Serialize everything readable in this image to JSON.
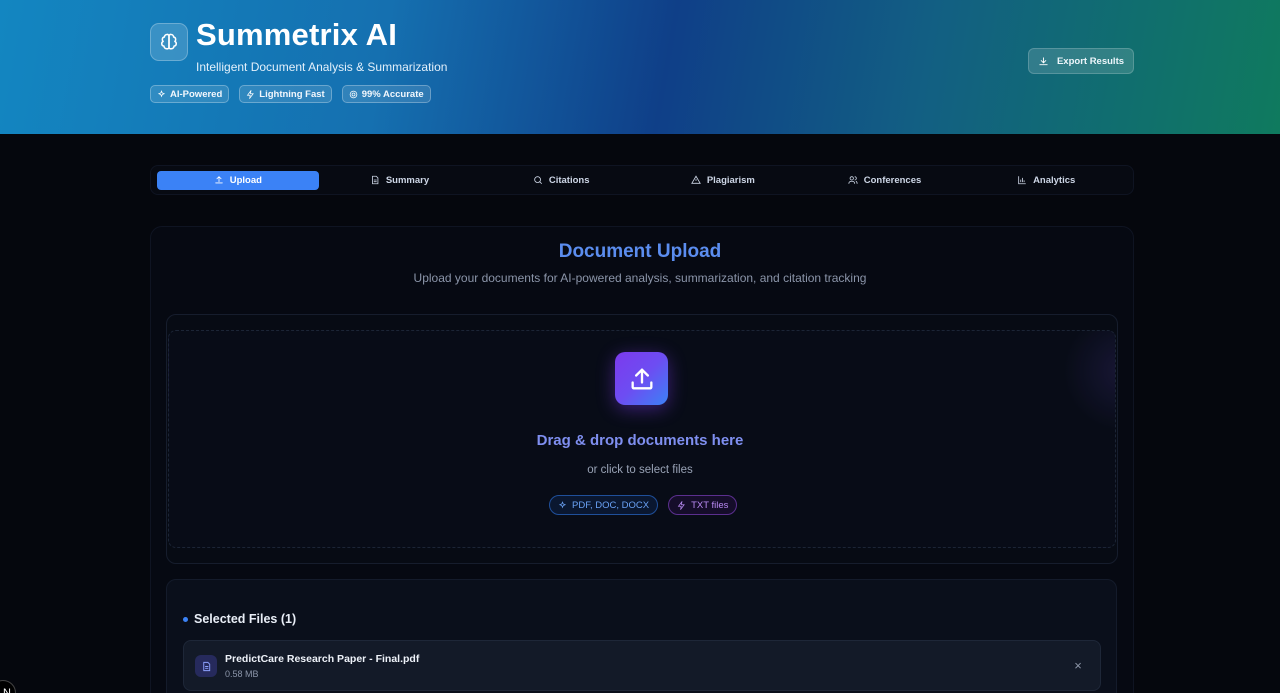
{
  "header": {
    "title": "Summetrix AI",
    "subtitle": "Intelligent Document Analysis & Summarization",
    "logo_icon": "brain-icon",
    "badges": [
      {
        "label": "AI-Powered",
        "icon": "sparkles-icon"
      },
      {
        "label": "Lightning Fast",
        "icon": "zap-icon"
      },
      {
        "label": "99% Accurate",
        "icon": "target-icon"
      }
    ],
    "export_label": "Export Results",
    "export_icon": "download-icon"
  },
  "tabs": [
    {
      "label": "Upload",
      "icon": "upload-icon",
      "active": true
    },
    {
      "label": "Summary",
      "icon": "file-text-icon",
      "active": false
    },
    {
      "label": "Citations",
      "icon": "search-icon",
      "active": false
    },
    {
      "label": "Plagiarism",
      "icon": "alert-triangle-icon",
      "active": false
    },
    {
      "label": "Conferences",
      "icon": "users-icon",
      "active": false
    },
    {
      "label": "Analytics",
      "icon": "bar-chart-icon",
      "active": false
    }
  ],
  "upload": {
    "title": "Document Upload",
    "subtitle": "Upload your documents for AI-powered analysis, summarization, and citation tracking",
    "drop_title": "Drag & drop documents here",
    "drop_sub": "or click to select files",
    "types": [
      {
        "label": "PDF, DOC, DOCX",
        "icon": "sparkles-icon"
      },
      {
        "label": "TXT files",
        "icon": "zap-icon"
      }
    ]
  },
  "files": {
    "heading": "Selected Files (1)",
    "items": [
      {
        "name": "PredictCare Research Paper - Final.pdf",
        "size": "0.58 MB"
      }
    ],
    "remove_glyph": "×"
  },
  "corner_badge": "N",
  "colors": {
    "accent": "#3b82f6",
    "purple": "#7c3aed",
    "background": "#05070d"
  }
}
